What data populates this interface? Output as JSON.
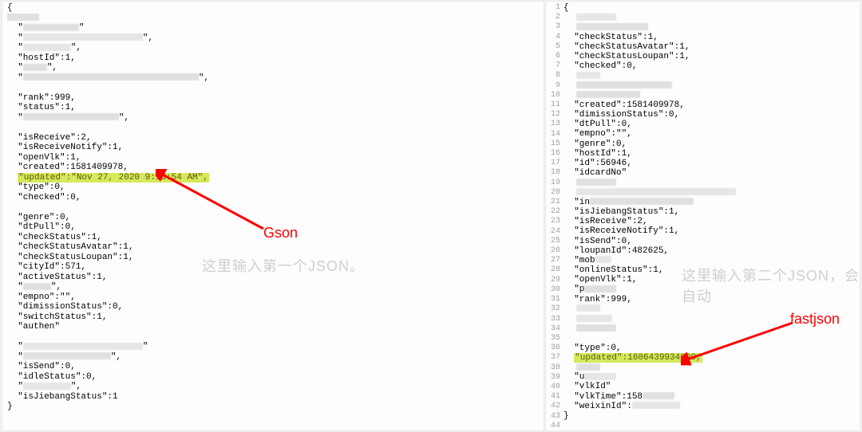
{
  "left": {
    "label": "Gson",
    "placeholder": "这里输入第一个JSON。",
    "highlight": "\"updated\":\"Nov 27, 2020 9:18:54 AM\",",
    "lines": [
      {
        "text": "{"
      },
      {
        "blurW": 40
      },
      {
        "text": "  \"",
        "blurW": 70,
        "post": "\""
      },
      {
        "text": "  \"",
        "blurW": 150,
        "post": "\","
      },
      {
        "text": "  \"",
        "blurW": 60,
        "post": "\","
      },
      {
        "text": "  \"hostId\":1,"
      },
      {
        "text": "  \"",
        "blurW": 30,
        "post": "\","
      },
      {
        "text": "  \"",
        "blurW": 220,
        "post": "\","
      },
      {
        "blurW": 0
      },
      {
        "text": "  \"rank\":999,"
      },
      {
        "text": "  \"status\":1,"
      },
      {
        "text": "  \"",
        "blurW": 120,
        "post": "\","
      },
      {
        "blurW": 0
      },
      {
        "text": "  \"isReceive\":2,"
      },
      {
        "text": "  \"isReceiveNotify\":1,"
      },
      {
        "text": "  \"openVlk\":1,"
      },
      {
        "text": "  \"created\":1581409978,"
      },
      {
        "highlight": true
      },
      {
        "text": "  \"type\":0,"
      },
      {
        "text": "  \"checked\":0,"
      },
      {
        "blurW": 0
      },
      {
        "text": "  \"genre\":0,"
      },
      {
        "text": "  \"dtPull\":0,"
      },
      {
        "text": "  \"checkStatus\":1,"
      },
      {
        "text": "  \"checkStatusAvatar\":1,"
      },
      {
        "text": "  \"checkStatusLoupan\":1,"
      },
      {
        "text": "  \"cityId\":571,"
      },
      {
        "text": "  \"activeStatus\":1,"
      },
      {
        "text": "  \"",
        "blurW": 35,
        "post": "\","
      },
      {
        "text": "  \"empno\":\"\","
      },
      {
        "text": "  \"dimissionStatus\":0,"
      },
      {
        "text": "  \"switchStatus\":1,"
      },
      {
        "text": "  \"authen",
        "post": "\""
      },
      {
        "blurW": 0
      },
      {
        "text": "  \"",
        "blurW": 150,
        "post": "\""
      },
      {
        "text": "  \"",
        "blurW": 110,
        "post": "\","
      },
      {
        "text": "  \"isSend\":0,"
      },
      {
        "text": "  \"idleStatus\":0,"
      },
      {
        "text": "  \"",
        "blurW": 60,
        "post": "\","
      },
      {
        "text": "  \"isJiebangStatus\":1"
      },
      {
        "text": "}"
      }
    ]
  },
  "right": {
    "label": "fastjson",
    "placeholder": "这里输入第二个JSON，会自动",
    "highlight": "\"updated\":1606439934000,",
    "lines": [
      {
        "n": 1,
        "text": "{"
      },
      {
        "n": 2,
        "pre": 16,
        "blurW": 50
      },
      {
        "n": 3,
        "pre": 16,
        "blurW": 90
      },
      {
        "n": 4,
        "text": "  \"checkStatus\":1,"
      },
      {
        "n": 5,
        "text": "  \"checkStatusAvatar\":1,"
      },
      {
        "n": 6,
        "text": "  \"checkStatusLoupan\":1,"
      },
      {
        "n": 7,
        "text": "  \"checked\":0,"
      },
      {
        "n": 8,
        "pre": 16,
        "blurW": 30
      },
      {
        "n": 9,
        "pre": 16,
        "blurW": 120
      },
      {
        "n": 10,
        "pre": 16,
        "blurW": 80
      },
      {
        "n": 11,
        "text": "  \"created\":1581409978,"
      },
      {
        "n": 12,
        "text": "  \"dimissionStatus\":0,"
      },
      {
        "n": 13,
        "text": "  \"dtPull\":0,"
      },
      {
        "n": 14,
        "text": "  \"empno\":\"\","
      },
      {
        "n": 15,
        "text": "  \"genre\":0,"
      },
      {
        "n": 16,
        "text": "  \"hostId\":1,"
      },
      {
        "n": 17,
        "text": "  \"id\":56946,"
      },
      {
        "n": 18,
        "text": "  \"idcardNo\""
      },
      {
        "n": 19,
        "pre": 16,
        "blurW": 50
      },
      {
        "n": 20,
        "pre": 16,
        "blurW": 200
      },
      {
        "n": 21,
        "text": "  \"in",
        "blurW": 130
      },
      {
        "n": 22,
        "text": "  \"isJiebangStatus\":1,"
      },
      {
        "n": 23,
        "text": "  \"isReceive\":2,"
      },
      {
        "n": 24,
        "text": "  \"isReceiveNotify\":1,"
      },
      {
        "n": 25,
        "text": "  \"isSend\":0,"
      },
      {
        "n": 26,
        "text": "  \"loupanId\":482625,"
      },
      {
        "n": 27,
        "text": "  \"mob",
        "blurW": 20
      },
      {
        "n": 28,
        "text": "  \"onlineStatus\":1,"
      },
      {
        "n": 29,
        "text": "  \"openVlk\":1,"
      },
      {
        "n": 30,
        "text": "  \"p",
        "blurW": 40
      },
      {
        "n": 31,
        "text": "  \"rank\":999,"
      },
      {
        "n": 32,
        "pre": 16,
        "blurW": 30
      },
      {
        "n": 33,
        "pre": 16,
        "blurW": 45
      },
      {
        "n": 34,
        "pre": 16,
        "blurW": 50
      },
      {
        "n": 35,
        "pre": 16,
        "blurW": 0
      },
      {
        "n": 36,
        "text": "  \"type\":0,"
      },
      {
        "n": 37,
        "highlight": true
      },
      {
        "n": 38,
        "pre": 16,
        "blurW": 30
      },
      {
        "n": 39,
        "text": "  \"u",
        "blurW": 40
      },
      {
        "n": 40,
        "text": "  \"vlkId\""
      },
      {
        "n": 41,
        "text": "  \"vlkTime\":158",
        "blurW": 40
      },
      {
        "n": 42,
        "text": "  \"weixinId\":",
        "blurW": 60
      },
      {
        "n": 43,
        "text": "}"
      },
      {
        "n": 44,
        "text": ""
      }
    ]
  },
  "colors": {
    "highlight_bg": "#d6e85b",
    "arrow": "#ff0000"
  }
}
